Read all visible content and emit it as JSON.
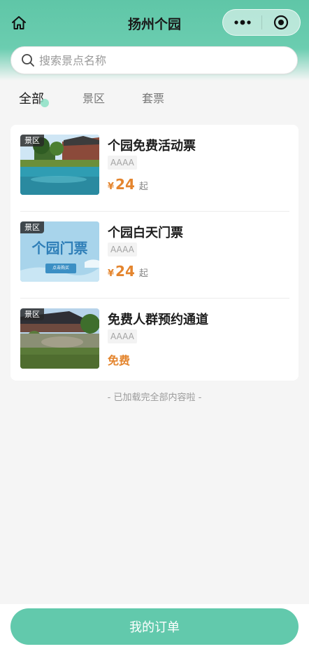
{
  "header": {
    "title": "扬州个园",
    "home_icon": "home-icon",
    "more_icon": "more-dots-icon",
    "close_icon": "target-close-icon"
  },
  "search": {
    "placeholder": "搜索景点名称",
    "value": ""
  },
  "tabs": [
    {
      "label": "全部",
      "active": true
    },
    {
      "label": "景区",
      "active": false
    },
    {
      "label": "套票",
      "active": false
    }
  ],
  "items": [
    {
      "badge": "景区",
      "name": "个园免费活动票",
      "level": "AAAA",
      "currency": "¥",
      "price": "24",
      "suffix": "起"
    },
    {
      "badge": "景区",
      "name": "个园白天门票",
      "level": "AAAA",
      "currency": "¥",
      "price": "24",
      "suffix": "起",
      "thumb_title": "个园门票",
      "thumb_button": "点击购买"
    },
    {
      "badge": "景区",
      "name": "免费人群预约通道",
      "level": "AAAA",
      "free_label": "免费"
    }
  ],
  "end_note": "- 已加载完全部内容啦 -",
  "bottom": {
    "order_button": "我的订单"
  },
  "colors": {
    "brand": "#62c9ac",
    "price": "#e4852e"
  }
}
